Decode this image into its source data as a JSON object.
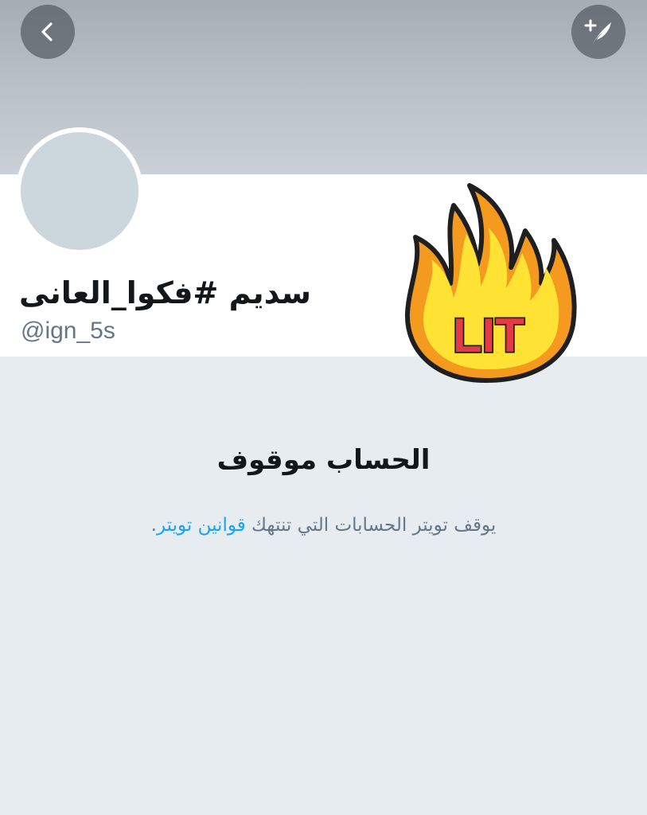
{
  "header": {
    "back_icon": "chevron-left-icon",
    "compose_icon": "compose-tweet-icon"
  },
  "profile": {
    "display_name": "سديم #فكوا_العانى",
    "handle": "@ign_5s",
    "sticker": {
      "text": "LIT",
      "icon": "fire-icon"
    }
  },
  "suspended": {
    "title": "الحساب موقوف",
    "description_prefix": "يوقف تويتر الحسابات التي تنتهك",
    "rules_link": "قوانين تويتر",
    "description_suffix": "."
  },
  "colors": {
    "link": "#1da1f2",
    "muted_text": "#657786",
    "background": "#e6ecf0",
    "avatar_placeholder": "#ccd6dd"
  }
}
